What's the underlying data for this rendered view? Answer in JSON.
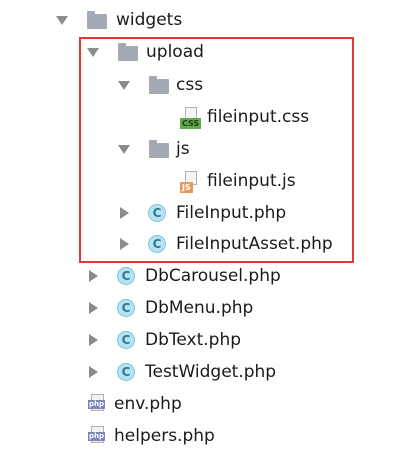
{
  "tree": {
    "widgets": {
      "label": "widgets",
      "icon": "folder-icon"
    },
    "upload": {
      "label": "upload",
      "icon": "folder-icon"
    },
    "css_folder": {
      "label": "css",
      "icon": "folder-icon"
    },
    "css_file": {
      "label": "fileinput.css",
      "icon": "css-file-icon",
      "tag": "CSS"
    },
    "js_folder": {
      "label": "js",
      "icon": "folder-icon"
    },
    "js_file": {
      "label": "fileinput.js",
      "icon": "js-file-icon",
      "tag": "JS"
    },
    "file_input": {
      "label": "FileInput.php",
      "icon": "php-class-icon",
      "glyph": "C"
    },
    "file_input_asset": {
      "label": "FileInputAsset.php",
      "icon": "php-class-icon",
      "glyph": "C"
    },
    "db_carousel": {
      "label": "DbCarousel.php",
      "icon": "php-class-icon",
      "glyph": "C"
    },
    "db_menu": {
      "label": "DbMenu.php",
      "icon": "php-class-icon",
      "glyph": "C"
    },
    "db_text": {
      "label": "DbText.php",
      "icon": "php-class-icon",
      "glyph": "C"
    },
    "test_widget": {
      "label": "TestWidget.php",
      "icon": "php-class-icon",
      "glyph": "C"
    },
    "env": {
      "label": "env.php",
      "icon": "php-file-icon",
      "tag": "php"
    },
    "helpers": {
      "label": "helpers.php",
      "icon": "php-file-icon",
      "tag": "php"
    }
  },
  "colors": {
    "highlight_border": "#e0393c",
    "folder": "#a4aab3",
    "class_icon": "#b7e3f0",
    "css_tag": "#5fa84d",
    "js_tag": "#e69a5c",
    "php_tag": "#7a86b8"
  }
}
